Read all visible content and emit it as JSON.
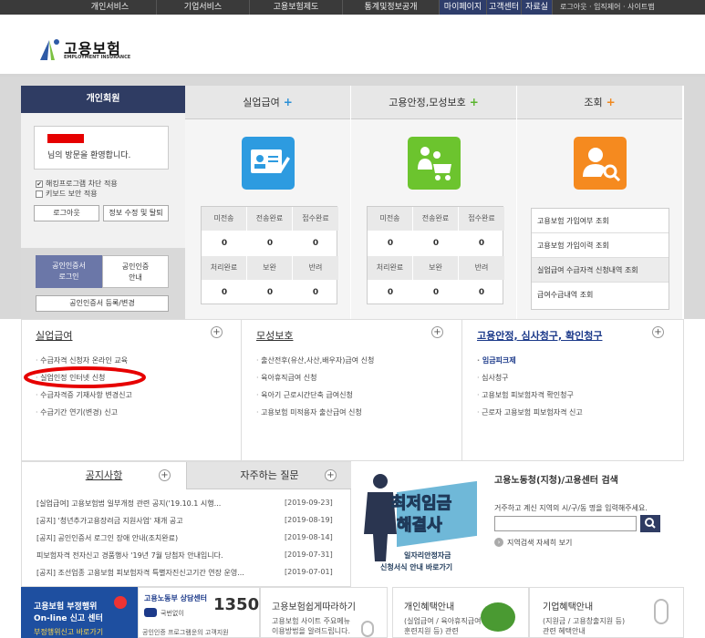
{
  "topnav": {
    "items": [
      "개인서비스",
      "기업서비스",
      "고용보험제도",
      "통계및정보공개"
    ],
    "mypage": "마이페이지",
    "customer": "고객센터",
    "resources": "자료실",
    "util": "로그아웃 · 임직제어 · 사이트맵"
  },
  "logo": {
    "title": "고용보험",
    "subtitle": "EMPLOYMENT INSURANCE"
  },
  "member": {
    "tab": "개인회원",
    "welcome": "님의 방문을 환영합니다.",
    "check1": "해킹프로그램 차단 적용",
    "check2": "키보드 보안 적용",
    "logout": "로그아웃",
    "edit": "정보 수정 및 탈퇴",
    "cert_login_1": "공인인증서",
    "cert_login_2": "로그인",
    "cert_guide_1": "공인인증",
    "cert_guide_2": "안내",
    "cert_register": "공인인증서 등록/변경"
  },
  "columns": [
    {
      "title": "실업급여",
      "plus": "+",
      "plus_color": "#2a8fd6",
      "icon_color": "#2d9be0"
    },
    {
      "title": "고용안정,모성보호",
      "plus": "+",
      "plus_color": "#5ab52e",
      "icon_color": "#6cc42e"
    },
    {
      "title": "조회",
      "plus": "+",
      "plus_color": "#f0881e",
      "icon_color": "#f58a1f"
    }
  ],
  "stats_labels_top": [
    "미전송",
    "전송완료",
    "접수완료"
  ],
  "stats_labels_bottom": [
    "처리완료",
    "보완",
    "반려"
  ],
  "stats1": {
    "top": [
      "0",
      "0",
      "0"
    ],
    "bottom": [
      "0",
      "0",
      "0"
    ]
  },
  "stats2": {
    "top": [
      "0",
      "0",
      "0"
    ],
    "bottom": [
      "0",
      "0",
      "0"
    ]
  },
  "query_items": [
    "고용보험 가입여부 조회",
    "고용보험 가입이력 조회",
    "실업급여 수급자격 신청내역 조회",
    "급여수급내역 조회"
  ],
  "menus": [
    {
      "title": "실업급여",
      "links": [
        "수급자격 신청자 온라인 교육",
        "실업인정 인터넷 신청",
        "수급자격증 기재사항 변경신고",
        "수급기간 연기(변경) 신고"
      ]
    },
    {
      "title": "모성보호",
      "links": [
        "출산전후(유산,사산,배우자)급여 신청",
        "육아휴직급여 신청",
        "육아기 근로시간단축 급여신청",
        "고용보험 미적용자 출산급여 신청"
      ]
    },
    {
      "title": "고용안정, 심사청구, 확인청구",
      "links": [
        "임금피크제",
        "심사청구",
        "고용보험 피보험자격 확인청구",
        "근로자 고용보험 피보험자격 신고"
      ]
    }
  ],
  "notice": {
    "tab1": "공지사항",
    "tab2": "자주하는 질문",
    "rows": [
      {
        "t": "[실업급여] 고용보험법 일부개정 관련 공지('19.10.1 시행...",
        "d": "[2019-09-23]"
      },
      {
        "t": "[공지] '청년추가고용장려금 지원사업' 재개 공고",
        "d": "[2019-08-19]"
      },
      {
        "t": "[공지] 공인인증서 로그인 장애 안내(조치완료)",
        "d": "[2019-08-14]"
      },
      {
        "t": "피보험자격 전자신고 경품행사 '19년 7월 당첨자 안내입니다.",
        "d": "[2019-07-31]"
      },
      {
        "t": "[공지] 조선업종 고용보험 피보험자격 특별자진신고기간 연장 운영...",
        "d": "[2019-07-01]"
      }
    ]
  },
  "wage": {
    "line1": "최저임금",
    "line2": "해결사",
    "cap1": "일자리안정자금",
    "cap2": "신청서식 안내 바로가기"
  },
  "search": {
    "title": "고용노동청(지청)/고용센터 검색",
    "desc": "거주하고 계신 지역의 시/구/동 명을 입력해주세요.",
    "input_value": "",
    "detail": "지역검색 자세히 보기"
  },
  "bottom": {
    "report_title_1": "고용보험 부정행위",
    "report_title_2": "On-line 신고 센터",
    "report_link": "부정행위신고 바로가기",
    "call_title": "고용노동부 상담센터",
    "call_sub": "국번없이",
    "call_num": "1350",
    "call_cert": "공인인증 프로그램운의 고객지원",
    "easy_title": "고용보험쉽게따라하기",
    "easy_desc_1": "고용보험 사이트 주요메뉴",
    "easy_desc_2": "이용방법을 알려드립니다.",
    "personal_title": "개인혜택안내",
    "personal_desc_1": "(실업급여 / 육아휴직급여 /",
    "personal_desc_2": "훈련지원 등) 관련",
    "corp_title": "기업혜택안내",
    "corp_desc_1": "(지원금 / 고용창출지원 등)",
    "corp_desc_2": "관련 혜택안내"
  },
  "colors": {
    "navy": "#2f3c63",
    "accent_red": "#e60000",
    "blue_link": "#1c3a8a"
  }
}
